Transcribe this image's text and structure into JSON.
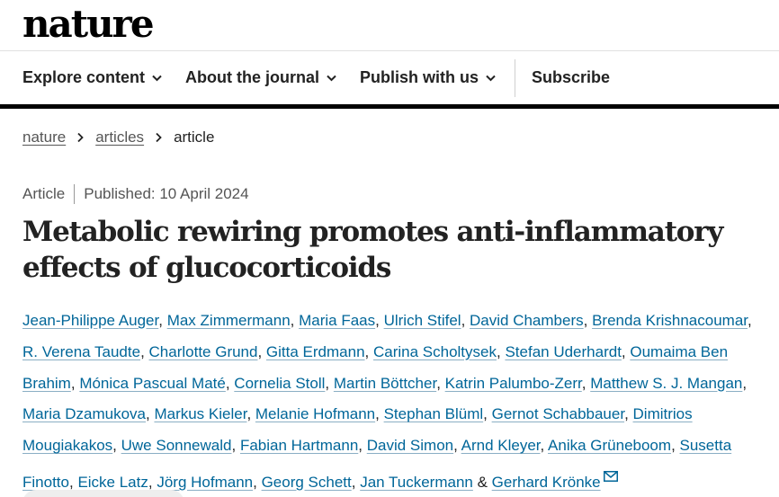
{
  "logo": {
    "text": "nature"
  },
  "nav": {
    "items": [
      {
        "label": "Explore content"
      },
      {
        "label": "About the journal"
      },
      {
        "label": "Publish with us"
      }
    ],
    "subscribe": "Subscribe"
  },
  "breadcrumb": {
    "items": [
      "nature",
      "articles"
    ],
    "current": "article"
  },
  "article": {
    "type": "Article",
    "published": "Published: 10 April 2024",
    "title": "Metabolic rewiring promotes anti-inflammatory effects of glucocorticoids",
    "authors": [
      "Jean-Philippe Auger",
      "Max Zimmermann",
      "Maria Faas",
      "Ulrich Stifel",
      "David Chambers",
      "Brenda Krishnacoumar",
      "R. Verena Taudte",
      "Charlotte Grund",
      "Gitta Erdmann",
      "Carina Scholtysek",
      "Stefan Uderhardt",
      "Oumaima Ben Brahim",
      "Mónica Pascual Maté",
      "Cornelia Stoll",
      "Martin Böttcher",
      "Katrin Palumbo-Zerr",
      "Matthew S. J. Mangan",
      "Maria Dzamukova",
      "Markus Kieler",
      "Melanie Hofmann",
      "Stephan Blüml",
      "Gernot Schabbauer",
      "Dimitrios Mougiakakos",
      "Uwe Sonnewald",
      "Fabian Hartmann",
      "David Simon",
      "Arnd Kleyer",
      "Anika Grüneboom",
      "Susetta Finotto",
      "Eicke Latz",
      "Jörg Hofmann",
      "Georg Schett",
      "Jan Tuckermann",
      "Gerhard Krönke"
    ],
    "separator": ", ",
    "last_separator": " & ",
    "corresponding_icon": "mail-icon"
  },
  "colors": {
    "link": "#006699",
    "text": "#222222",
    "muted": "#555555"
  }
}
